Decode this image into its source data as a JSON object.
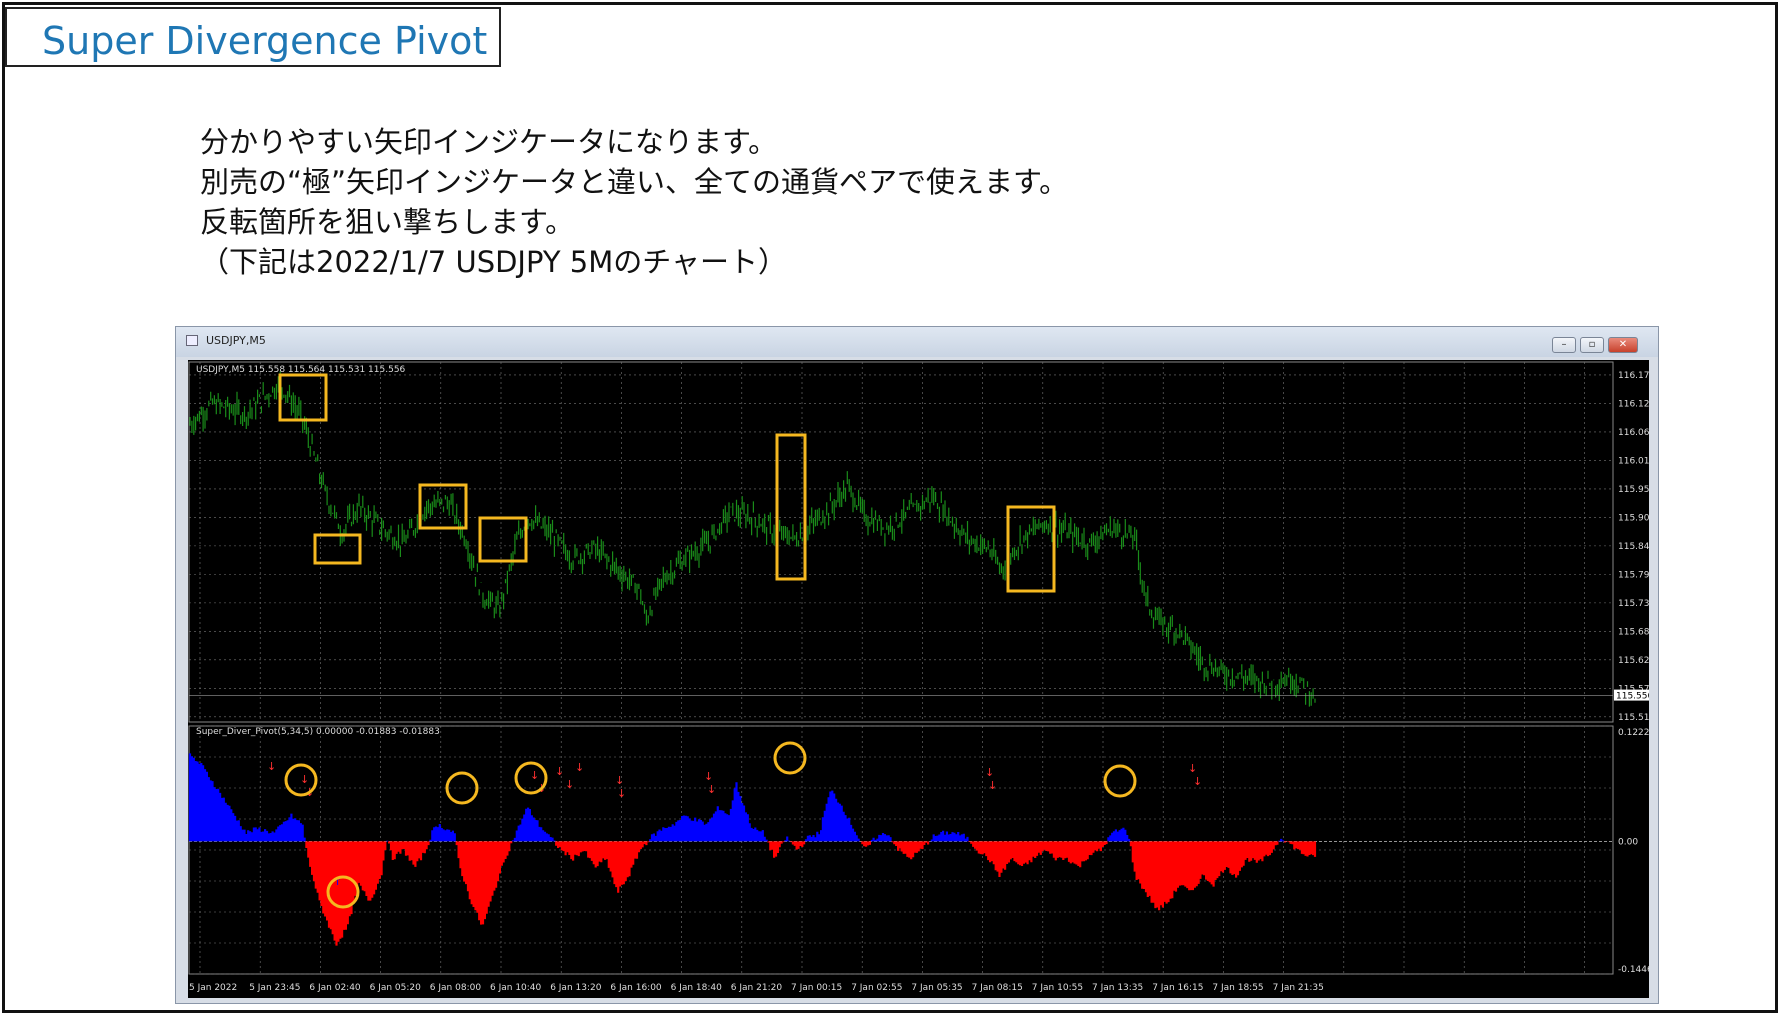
{
  "slide": {
    "title": "Super Divergence Pivot",
    "description": [
      "分かりやすい矢印インジケータになります。",
      "別売の“極”矢印インジケータと違い、全ての通貨ペアで使えます。",
      "反転箇所を狙い撃ちします。",
      "（下記は2022/1/7  USDJPY 5Mのチャート）"
    ]
  },
  "window": {
    "title": "USDJPY,M5",
    "buttons": [
      "minimize",
      "restore",
      "close"
    ]
  },
  "price_chart": {
    "header": "USDJPY,M5  115.558 115.564 115.531 115.556",
    "y_ticks": [
      "116.175",
      "116.120",
      "116.065",
      "116.010",
      "115.955",
      "115.900",
      "115.845",
      "115.790",
      "115.735",
      "115.680",
      "115.625",
      "115.570",
      "115.515"
    ],
    "current_price": "115.556",
    "colors": {
      "candles": "#1a8c1a",
      "highlight": "#f5b820",
      "grid": "#ffffff",
      "background": "#000000"
    }
  },
  "indicator": {
    "header": "Super_Diver_Pivot(5,34,5) 0.00000 -0.01883 -0.01883",
    "y_ticks": [
      "0.12229",
      "0.00",
      "-0.14469"
    ],
    "colors": {
      "positive": "#0000ff",
      "negative": "#ff0000",
      "arrow": "#ff3030"
    }
  },
  "x_ticks": [
    "5 Jan 2022",
    "5 Jan 23:45",
    "6 Jan 02:40",
    "6 Jan 05:20",
    "6 Jan 08:00",
    "6 Jan 10:40",
    "6 Jan 13:20",
    "6 Jan 16:00",
    "6 Jan 18:40",
    "6 Jan 21:20",
    "7 Jan 00:15",
    "7 Jan 02:55",
    "7 Jan 05:35",
    "7 Jan 08:15",
    "7 Jan 10:55",
    "7 Jan 13:35",
    "7 Jan 16:15",
    "7 Jan 18:55",
    "7 Jan 21:35"
  ]
}
